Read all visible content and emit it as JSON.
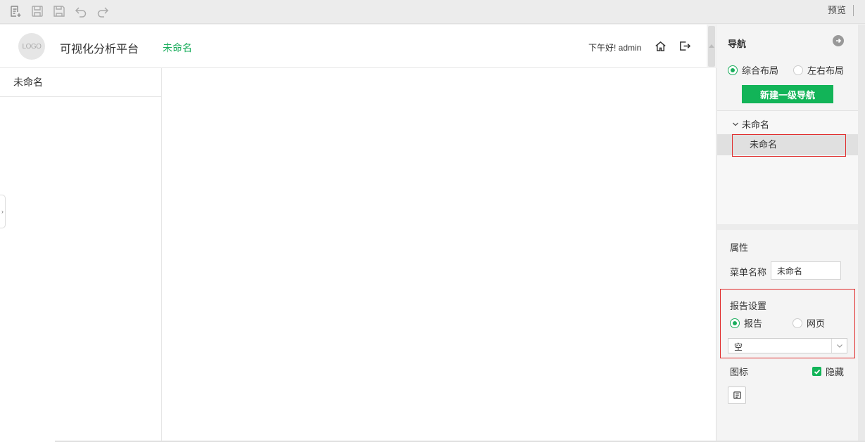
{
  "toolbar": {
    "icons": [
      "new-page-icon",
      "save-icon",
      "save-as-icon",
      "undo-icon",
      "redo-icon"
    ],
    "preview_label": "预览"
  },
  "app": {
    "logo_text": "LOGO",
    "title": "可视化分析平台",
    "active_tab": "未命名",
    "greeting": "下午好! admin",
    "header_icons": [
      "home-icon",
      "logout-icon"
    ]
  },
  "side_menu": {
    "items": [
      {
        "label": "未命名"
      }
    ]
  },
  "panel": {
    "nav_title": "导航",
    "layout_options": [
      {
        "label": "综合布局",
        "selected": true
      },
      {
        "label": "左右布局",
        "selected": false
      }
    ],
    "new_nav_button": "新建一级导航",
    "tree": {
      "parent": "未命名",
      "child": "未命名"
    },
    "attributes": {
      "title": "属性",
      "menu_name_label": "菜单名称",
      "menu_name_value": "未命名"
    },
    "report_settings": {
      "title": "报告设置",
      "options": [
        {
          "label": "报告",
          "selected": true
        },
        {
          "label": "网页",
          "selected": false
        }
      ],
      "select_value": "空"
    },
    "icon_label": "图标",
    "hide_label": "隐藏",
    "hide_checked": true
  },
  "colors": {
    "accent": "#1aad5c",
    "button": "#12b458",
    "highlight_border": "#e02b2b"
  }
}
